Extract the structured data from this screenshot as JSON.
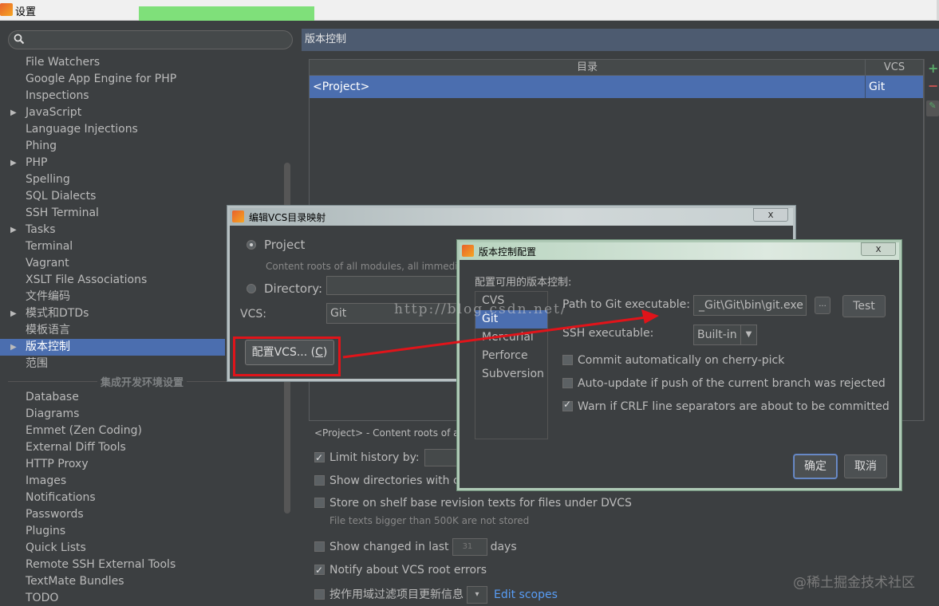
{
  "window": {
    "title": "设置"
  },
  "search": {
    "placeholder": ""
  },
  "tree": {
    "items": [
      {
        "label": "File Watchers",
        "expandable": false
      },
      {
        "label": "Google App Engine for PHP",
        "expandable": false
      },
      {
        "label": "Inspections",
        "expandable": false
      },
      {
        "label": "JavaScript",
        "expandable": true
      },
      {
        "label": "Language Injections",
        "expandable": false
      },
      {
        "label": "Phing",
        "expandable": false
      },
      {
        "label": "PHP",
        "expandable": true
      },
      {
        "label": "Spelling",
        "expandable": false
      },
      {
        "label": "SQL Dialects",
        "expandable": false
      },
      {
        "label": "SSH Terminal",
        "expandable": false
      },
      {
        "label": "Tasks",
        "expandable": true
      },
      {
        "label": "Terminal",
        "expandable": false
      },
      {
        "label": "Vagrant",
        "expandable": false
      },
      {
        "label": "XSLT File Associations",
        "expandable": false
      },
      {
        "label": "文件编码",
        "expandable": false
      },
      {
        "label": "模式和DTDs",
        "expandable": true
      },
      {
        "label": "模板语言",
        "expandable": false
      },
      {
        "label": "版本控制",
        "expandable": true,
        "selected": true
      },
      {
        "label": "范围",
        "expandable": false
      }
    ],
    "group_label": "集成开发环境设置",
    "ide_items": [
      "Database",
      "Diagrams",
      "Emmet (Zen Coding)",
      "External Diff Tools",
      "HTTP Proxy",
      "Images",
      "Notifications",
      "Passwords",
      "Plugins",
      "Quick Lists",
      "Remote SSH External Tools",
      "TextMate Bundles",
      "TODO"
    ]
  },
  "panel": {
    "title": "版本控制",
    "table": {
      "col_dir": "目录",
      "col_vcs": "VCS",
      "rows": [
        {
          "dir": "<Project>",
          "vcs": "Git"
        }
      ]
    },
    "tools": {
      "add": "+",
      "remove": "−",
      "edit": "✎"
    },
    "note": "<Project> - Content roots of a",
    "limit_history": "Limit history by:",
    "show_dirs": "Show directories with cl",
    "store_shelf": "Store on shelf base revision texts for files under DVCS",
    "store_shelf_sub": "File texts bigger than 500K are not stored",
    "show_changed": "Show changed in last",
    "show_changed_value": "31",
    "show_changed_unit": "days",
    "notify": "Notify about VCS root errors",
    "filter_scope": "按作用域过滤项目更新信息",
    "edit_scopes": "Edit scopes"
  },
  "dialog_map": {
    "title": "编辑VCS目录映射",
    "close": "x",
    "project_label": "Project",
    "project_sub": "Content roots of all modules, all immedia",
    "directory_label": "Directory:",
    "vcs_label": "VCS:",
    "vcs_value": "Git",
    "configure_prefix": "配置VCS... (",
    "configure_key": "C",
    "configure_suffix": ")"
  },
  "dialog_cfg": {
    "title": "版本控制配置",
    "close": "x",
    "caption": "配置可用的版本控制:",
    "vcs_list": [
      "CVS",
      "Git",
      "Mercurial",
      "Perforce",
      "Subversion"
    ],
    "selected_index": 1,
    "path_label": "Path to Git executable:",
    "path_value": "_Git\\Git\\bin\\git.exe",
    "browse": "...",
    "test": "Test",
    "ssh_label": "SSH executable:",
    "ssh_value": "Built-in",
    "opt_cherry": "Commit automatically on cherry-pick",
    "opt_autoupdate": "Auto-update if push of the current branch was rejected",
    "opt_crlf": "Warn if CRLF line separators are about to be committed",
    "ok": "确定",
    "cancel": "取消"
  },
  "watermarks": {
    "url": "http://blog.csdn.net/",
    "corner": "@稀土掘金技术社区"
  },
  "colors": {
    "selection": "#4b6eaf",
    "header": "#4d5b70",
    "annotation_red": "#e0141a"
  }
}
